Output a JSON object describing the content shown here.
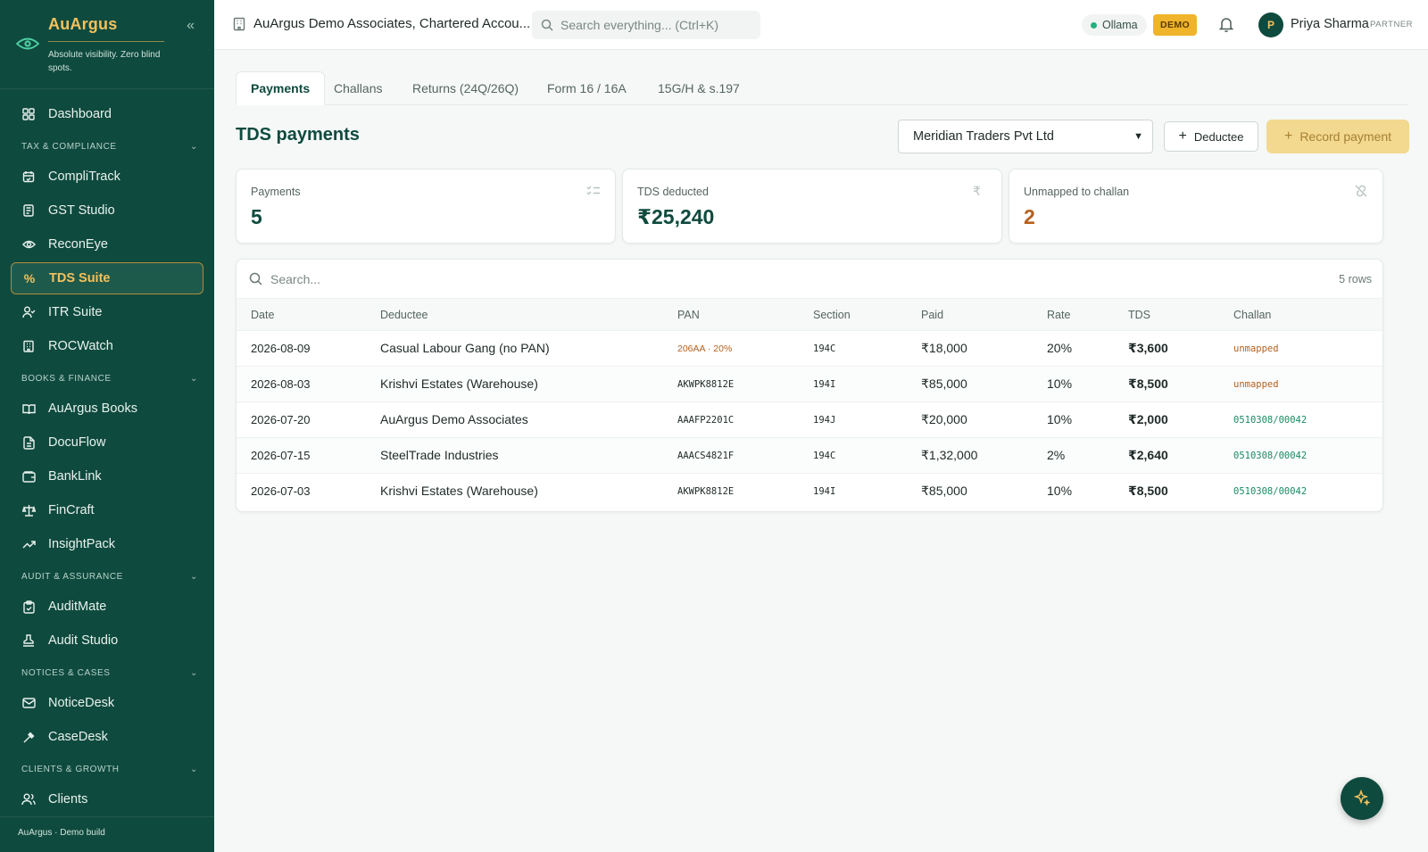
{
  "brand": {
    "name": "AuArgus",
    "tagline": "Absolute visibility. Zero blind spots.",
    "footer": "AuArgus · Demo build"
  },
  "nav": {
    "dashboard": "Dashboard",
    "sections": {
      "tax": "TAX & COMPLIANCE",
      "books": "BOOKS & FINANCE",
      "audit": "AUDIT & ASSURANCE",
      "notices": "NOTICES & CASES",
      "clients": "CLIENTS & GROWTH"
    },
    "items": {
      "complitrack": "CompliTrack",
      "gst": "GST Studio",
      "reconeye": "ReconEye",
      "tds": "TDS Suite",
      "itr": "ITR Suite",
      "roc": "ROCWatch",
      "books": "AuArgus Books",
      "docuflow": "DocuFlow",
      "banklink": "BankLink",
      "fincraft": "FinCraft",
      "insightpack": "InsightPack",
      "auditmate": "AuditMate",
      "auditstudio": "Audit Studio",
      "noticedesk": "NoticeDesk",
      "casedesk": "CaseDesk",
      "clients": "Clients"
    }
  },
  "topbar": {
    "org": "AuArgus Demo Associates, Chartered Accou...",
    "search_placeholder": "Search everything... (Ctrl+K)",
    "ollama": "Ollama",
    "demo": "DEMO",
    "avatar_initial": "P",
    "user": "Priya Sharma",
    "role": "PARTNER"
  },
  "tabs": [
    "Payments",
    "Challans",
    "Returns (24Q/26Q)",
    "Form 16 / 16A",
    "15G/H & s.197"
  ],
  "page": {
    "title": "TDS payments",
    "client": "Meridian Traders Pvt Ltd",
    "deductee_btn": "Deductee",
    "record_btn": "Record payment"
  },
  "cards": {
    "payments": {
      "label": "Payments",
      "value": "5"
    },
    "tds": {
      "label": "TDS deducted",
      "value": "₹25,240"
    },
    "unmapped": {
      "label": "Unmapped to challan",
      "value": "2"
    }
  },
  "table": {
    "search_placeholder": "Search...",
    "row_count": "5 rows",
    "columns": [
      "Date",
      "Deductee",
      "PAN",
      "Section",
      "Paid",
      "Rate",
      "TDS",
      "Challan"
    ],
    "rows": [
      {
        "date": "2026-08-09",
        "deductee": "Casual Labour Gang (no PAN)",
        "pan": "206AA · 20%",
        "section": "194C",
        "paid": "₹18,000",
        "rate": "20%",
        "tds": "₹3,600",
        "challan": "unmapped"
      },
      {
        "date": "2026-08-03",
        "deductee": "Krishvi Estates (Warehouse)",
        "pan": "AKWPK8812E",
        "section": "194I",
        "paid": "₹85,000",
        "rate": "10%",
        "tds": "₹8,500",
        "challan": "unmapped"
      },
      {
        "date": "2026-07-20",
        "deductee": "AuArgus Demo Associates",
        "pan": "AAAFP2201C",
        "section": "194J",
        "paid": "₹20,000",
        "rate": "10%",
        "tds": "₹2,000",
        "challan": "0510308/00042"
      },
      {
        "date": "2026-07-15",
        "deductee": "SteelTrade Industries",
        "pan": "AAACS4821F",
        "section": "194C",
        "paid": "₹1,32,000",
        "rate": "2%",
        "tds": "₹2,640",
        "challan": "0510308/00042"
      },
      {
        "date": "2026-07-03",
        "deductee": "Krishvi Estates (Warehouse)",
        "pan": "AKWPK8812E",
        "section": "194I",
        "paid": "₹85,000",
        "rate": "10%",
        "tds": "₹8,500",
        "challan": "0510308/00042"
      }
    ]
  }
}
